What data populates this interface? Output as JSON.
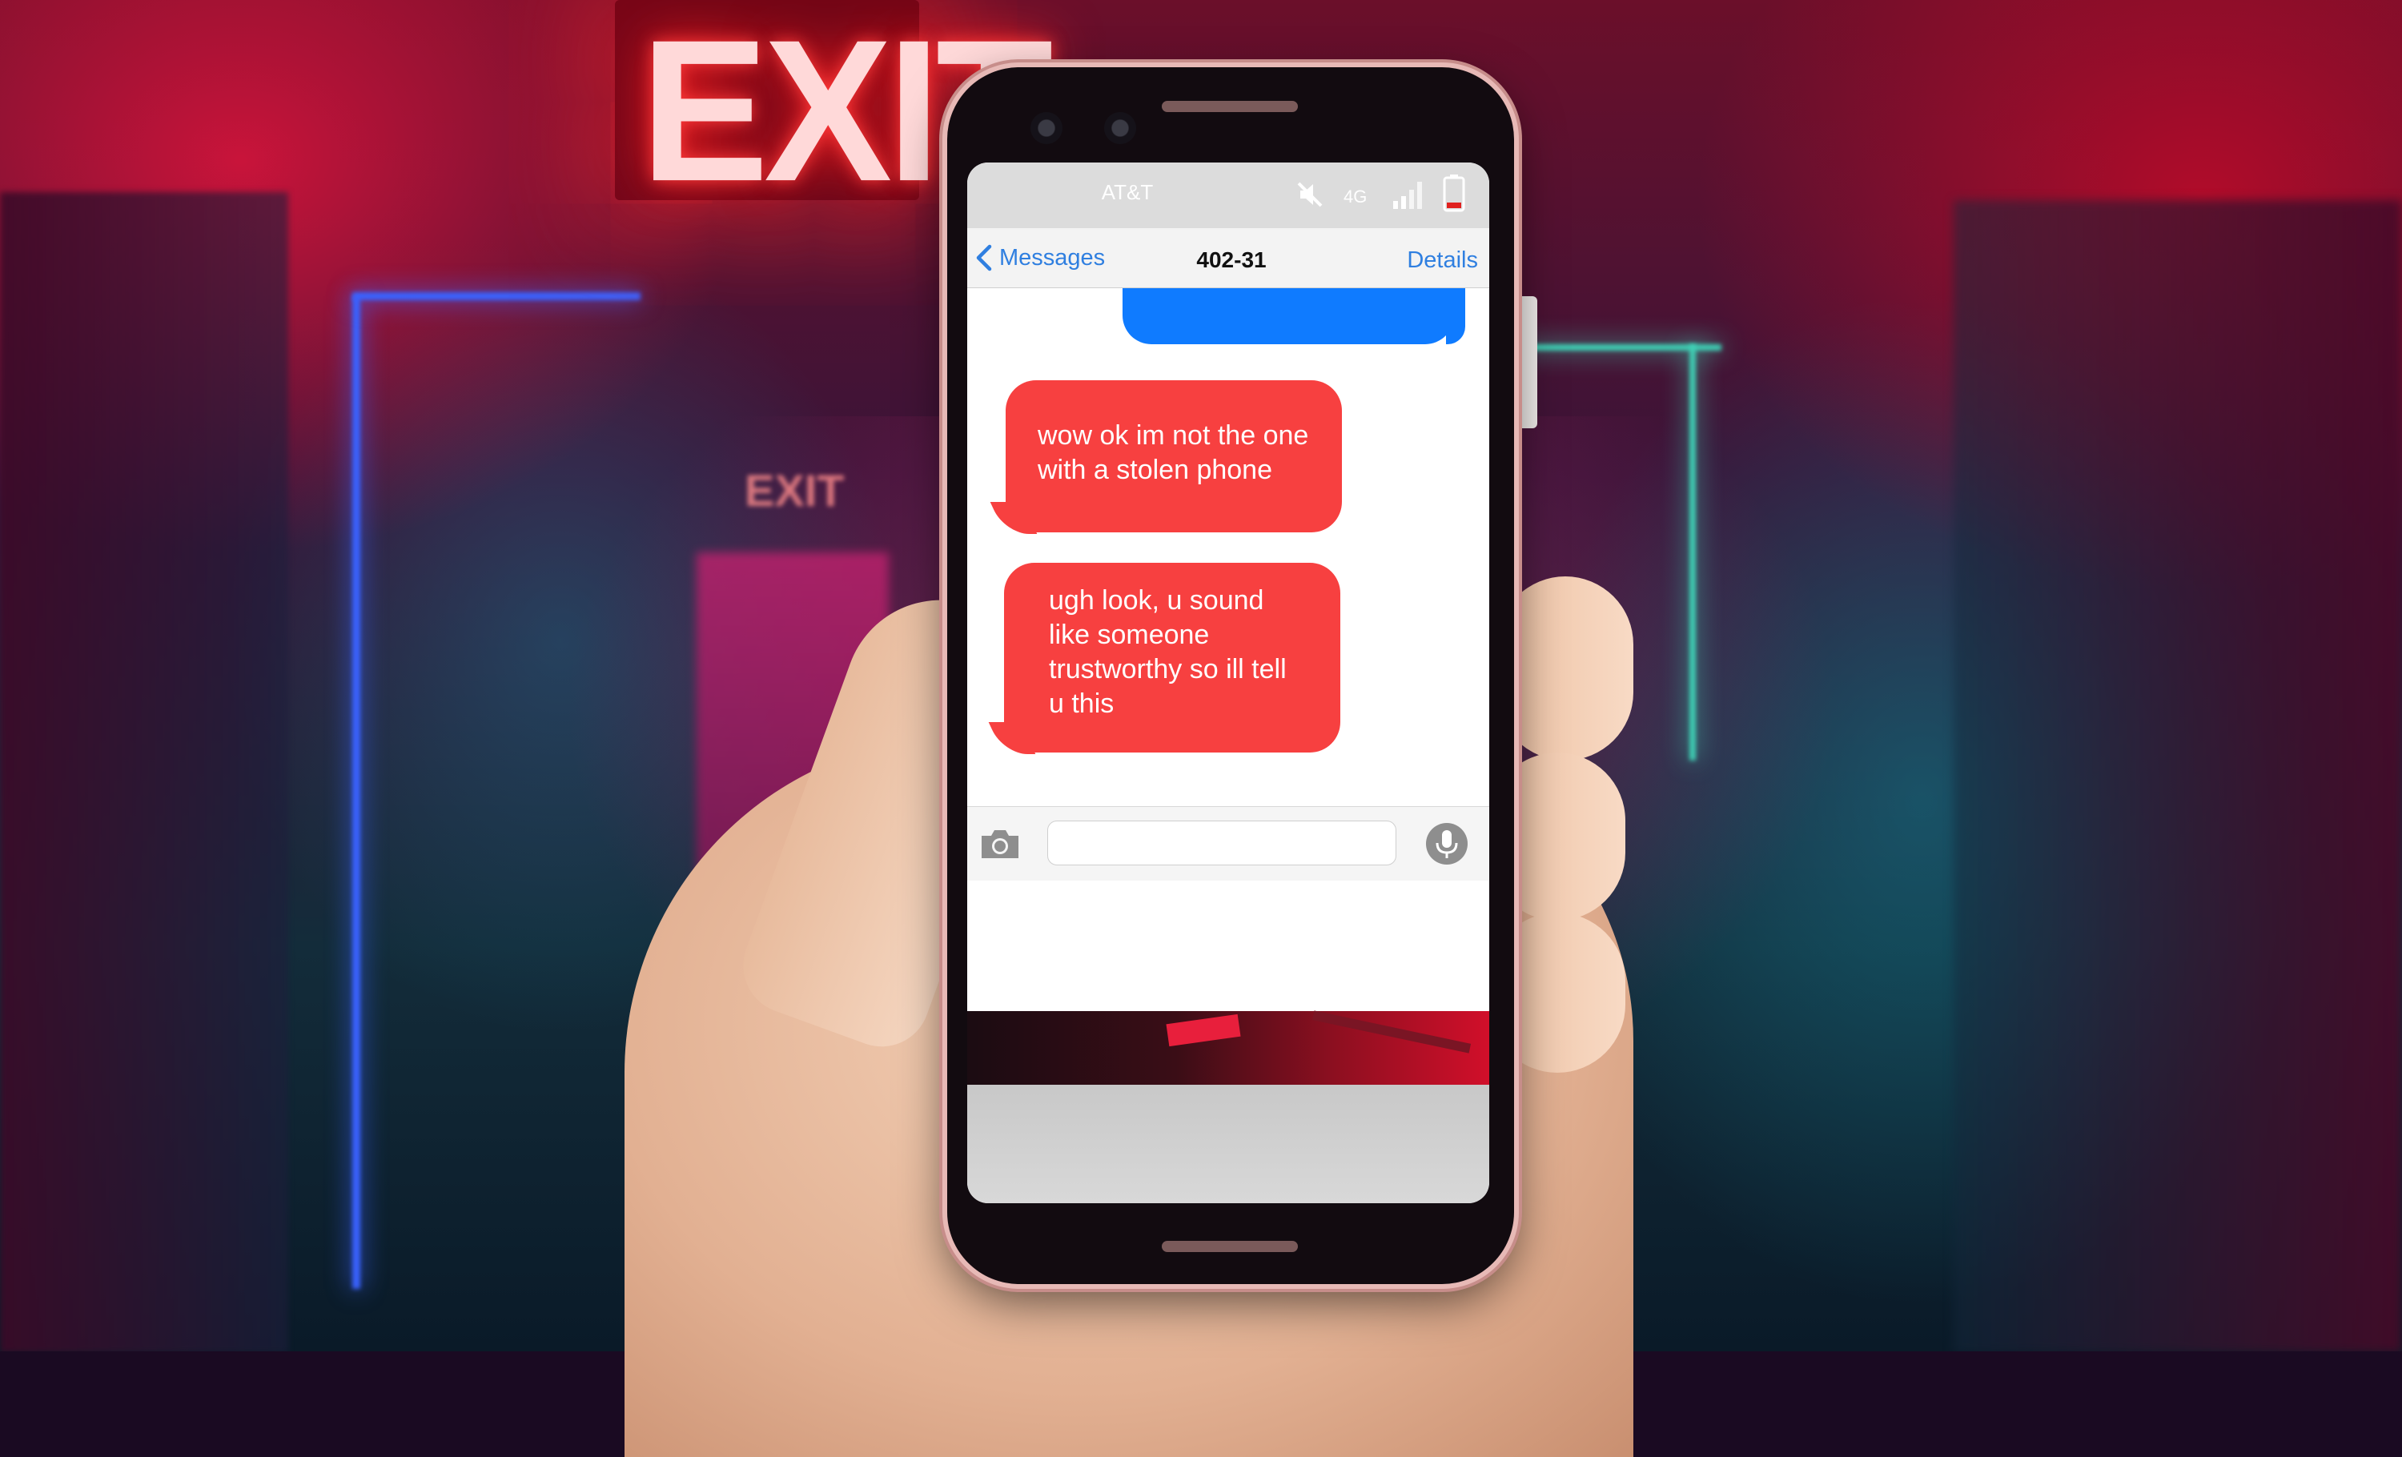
{
  "scene": {
    "exit_sign_text": "EXIT",
    "exit_sign_small_text": "EXIT"
  },
  "status_bar": {
    "carrier": "AT&T",
    "network": "4G",
    "mute_icon": "speaker-muted-icon",
    "signal_icon": "signal-bars-icon",
    "battery_icon": "battery-low-icon",
    "battery_level": 0.15,
    "battery_color": "#e0201e"
  },
  "nav": {
    "back_label": "Messages",
    "title": "402-31",
    "details_label": "Details",
    "link_color": "#2f7fe0"
  },
  "messages": [
    {
      "sender": "me",
      "text": "",
      "color": "#0f7bff"
    },
    {
      "sender": "other",
      "text": "wow ok im not the one with a stolen phone",
      "color": "#f74040"
    },
    {
      "sender": "other",
      "text": "ugh look, u sound like someone trustworthy so ill tell u this",
      "color": "#f74040"
    }
  ],
  "composer": {
    "camera_icon": "camera-icon",
    "input_value": "",
    "mic_icon": "microphone-icon"
  }
}
